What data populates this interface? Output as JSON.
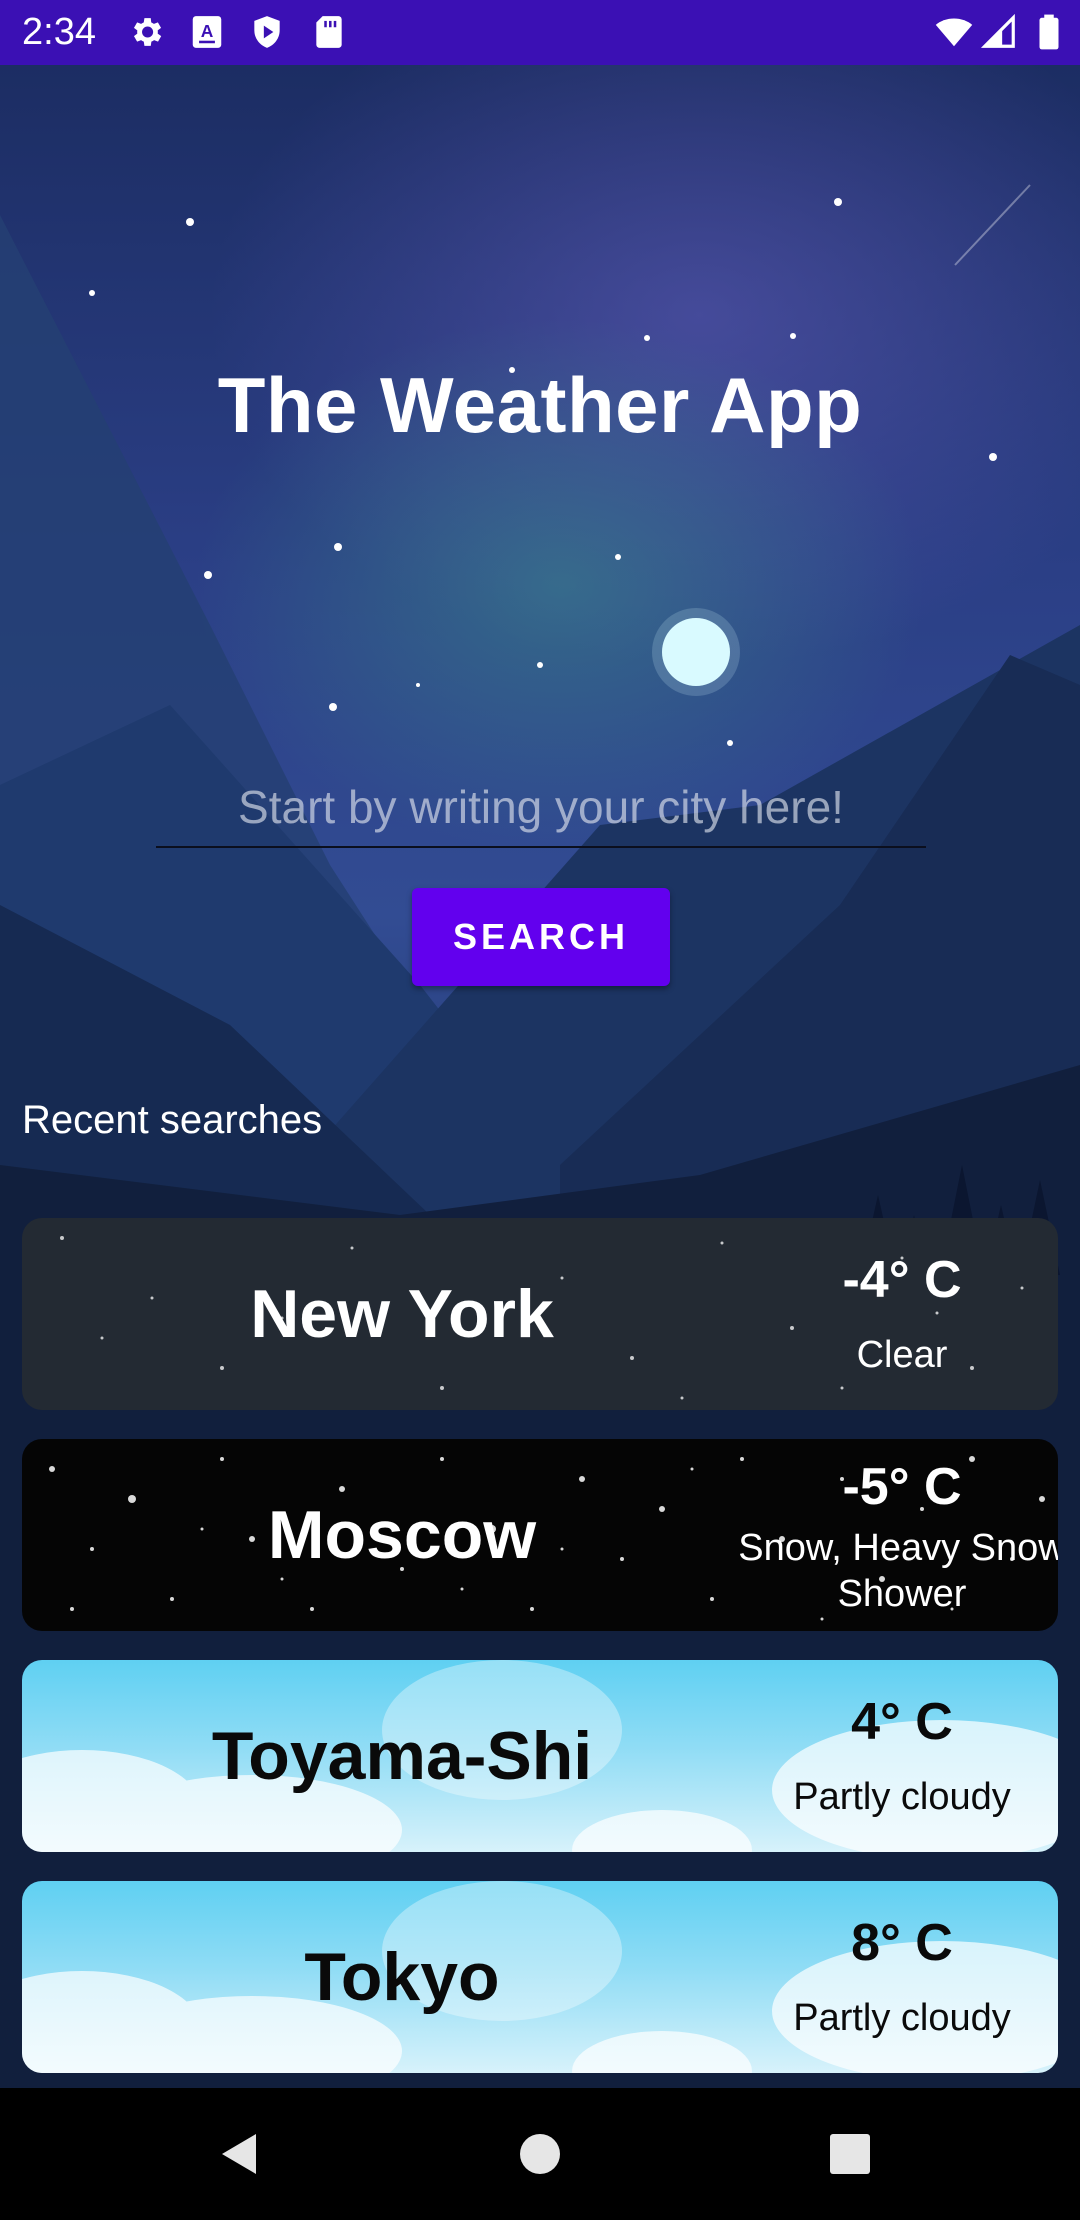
{
  "status_bar": {
    "time": "2:34",
    "icons": [
      "gear-icon",
      "keyboard-a-icon",
      "shield-play-icon",
      "sd-card-icon",
      "wifi-icon",
      "cell-signal-icon",
      "battery-icon"
    ]
  },
  "app": {
    "title": "The Weather App"
  },
  "search": {
    "placeholder": "Start by writing your city here!",
    "value": "",
    "button_label": "SEARCH"
  },
  "recent": {
    "label": "Recent searches",
    "items": [
      {
        "city": "New York",
        "temp": "-4° C",
        "condition": "Clear",
        "theme": "night-clear"
      },
      {
        "city": "Moscow",
        "temp": "-5° C",
        "condition": "Snow, Heavy Snow Shower",
        "theme": "snow"
      },
      {
        "city": "Toyama-Shi",
        "temp": "4° C",
        "condition": "Partly cloudy",
        "theme": "clouds"
      },
      {
        "city": "Tokyo",
        "temp": "8° C",
        "condition": "Partly cloudy",
        "theme": "clouds"
      }
    ]
  },
  "colors": {
    "status_bar": "#3b10b4",
    "accent": "#6200ee",
    "nav_bar": "#000000"
  },
  "nav": {
    "icons": [
      "back-icon",
      "home-icon",
      "recents-icon"
    ]
  }
}
